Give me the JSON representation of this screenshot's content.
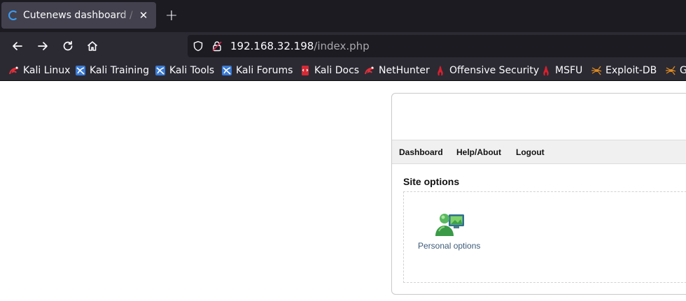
{
  "browser": {
    "tab": {
      "title": "Cutenews dashboard / Cu"
    },
    "url": {
      "host": "192.168.32.198",
      "path": "/index.php"
    },
    "bookmarks": [
      {
        "label": "Kali Linux",
        "icon": "kali-dragon-icon"
      },
      {
        "label": "Kali Training",
        "icon": "kali-training-icon"
      },
      {
        "label": "Kali Tools",
        "icon": "kali-tools-icon"
      },
      {
        "label": "Kali Forums",
        "icon": "kali-forums-icon"
      },
      {
        "label": "Kali Docs",
        "icon": "kali-docs-icon"
      },
      {
        "label": "NetHunter",
        "icon": "kali-dragon-icon"
      },
      {
        "label": "Offensive Security",
        "icon": "offsec-icon"
      },
      {
        "label": "MSFU",
        "icon": "offsec-icon"
      },
      {
        "label": "Exploit-DB",
        "icon": "exploitdb-icon"
      },
      {
        "label": "GHDB",
        "icon": "exploitdb-icon"
      }
    ]
  },
  "page": {
    "menu": {
      "dashboard": "Dashboard",
      "help": "Help/About",
      "logout": "Logout"
    },
    "section_title": "Site options",
    "options": [
      {
        "label": "Personal options",
        "icon": "user-computer-icon"
      }
    ]
  },
  "colors": {
    "tabstrip": "#1c1b22",
    "toolbar": "#2b2a33",
    "tab_active": "#42414d",
    "loading_accent": "#3b9cf5",
    "link": "#3c5a78"
  }
}
